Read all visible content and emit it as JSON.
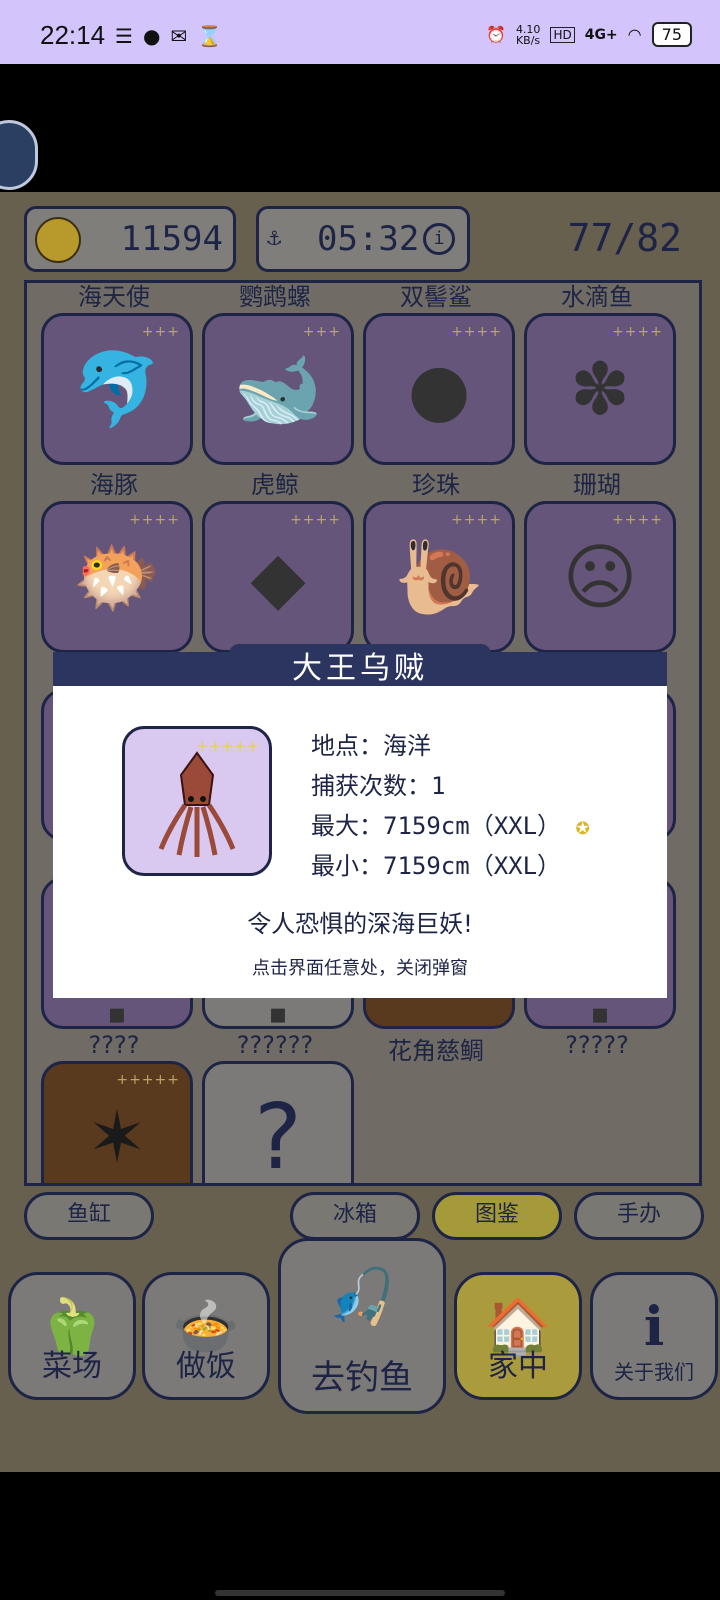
{
  "status_bar": {
    "time": "22:14",
    "net_speed": "4.10\nKB/s",
    "hd": "HD",
    "signal": "4G+",
    "battery": "75"
  },
  "header": {
    "coins": "11594",
    "timer": "05:32",
    "collection_count": "77/82"
  },
  "grid": {
    "row1_labels": [
      "海天使",
      "鹦鹉螺",
      "双髻鲨",
      "水滴鱼"
    ],
    "row2_labels": [
      "海豚",
      "虎鲸",
      "珍珠",
      "珊瑚"
    ],
    "row5_labels": [
      "????",
      "??????",
      "花角慈鲷",
      "?????"
    ],
    "unknown_mark": "?"
  },
  "modal": {
    "title": "大王乌贼",
    "stars": "+++++",
    "location": "地点：海洋",
    "catch_count": "捕获次数：1",
    "max": "最大：7159cm（XXL）",
    "min": "最小：7159cm（XXL）",
    "description": "令人恐惧的深海巨妖!",
    "close_hint": "点击界面任意处，关闭弹窗"
  },
  "tabs": {
    "aquarium": "鱼缸",
    "fridge": "冰箱",
    "encyclopedia": "图鉴",
    "figures": "手办"
  },
  "nav": {
    "farm": "菜场",
    "cook": "做饭",
    "fish": "去钓鱼",
    "home": "家中",
    "about": "关于我们"
  },
  "colors": {
    "accent_navy": "#1e2446",
    "modal_header": "#2b355f",
    "status_bar": "#d3c5fb"
  }
}
